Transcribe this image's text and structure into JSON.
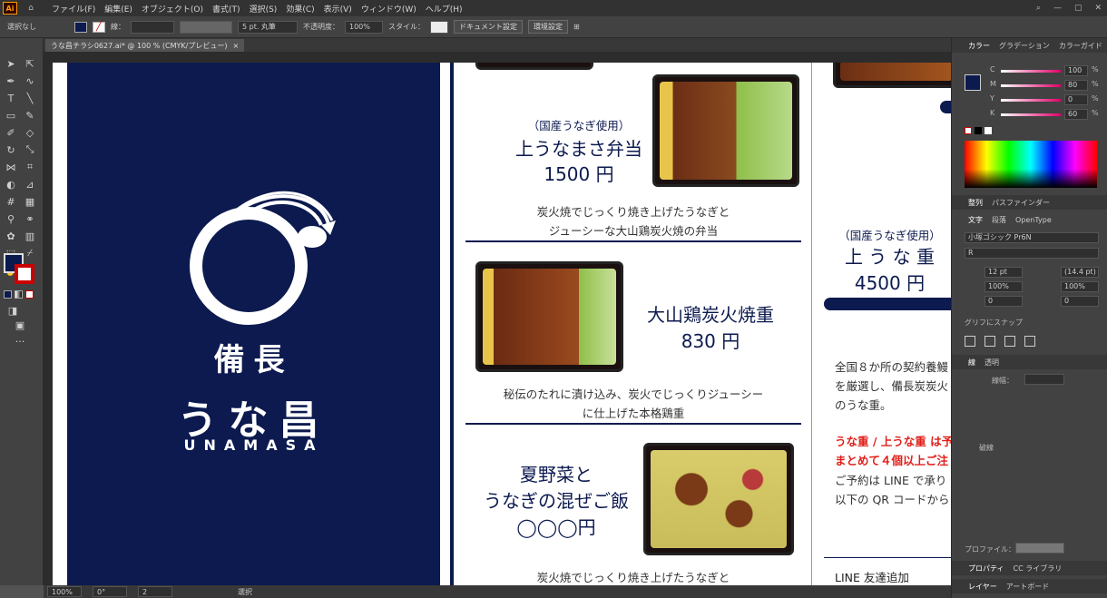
{
  "menu": {
    "app_badge": "Ai",
    "items": [
      "ファイル(F)",
      "編集(E)",
      "オブジェクト(O)",
      "書式(T)",
      "選択(S)",
      "効果(C)",
      "表示(V)",
      "ウィンドウ(W)",
      "ヘルプ(H)"
    ]
  },
  "control": {
    "selection": "選択なし",
    "stroke_label": "線：",
    "brush": "5 pt. 丸筆",
    "opacity_label": "不透明度：",
    "opacity": "100%",
    "style_label": "スタイル：",
    "doc_setup": "ドキュメント設定",
    "prefs": "環境設定"
  },
  "doc_tab": {
    "title": "うな昌チラシ0627.ai* @ 100 % (CMYK/プレビュー)",
    "close": "×"
  },
  "canvas": {
    "brand": {
      "line1": "備長",
      "line2": "うな昌",
      "line3": "UNAMASA"
    },
    "item1": {
      "tag": "（国産うなぎ使用）",
      "name": "上うなまさ弁当",
      "price": "1500 円",
      "desc1": "炭火焼でじっくり焼き上げたうなぎと",
      "desc2": "ジューシーな大山鶏炭火焼の弁当"
    },
    "item2": {
      "name": "大山鶏炭火焼重",
      "price": "830 円",
      "desc1": "秘伝のたれに漬け込み、炭火でじっくりジューシー",
      "desc2": "に仕上げた本格鶏重"
    },
    "item3": {
      "name1": "夏野菜と",
      "name2": "うなぎの混ぜご飯",
      "price": "◯◯◯円",
      "desc1": "炭火焼でじっくり焼き上げたうなぎと"
    },
    "item4": {
      "tag": "（国産うなぎ使用）",
      "name": "上 う な 重",
      "price": "4500 円"
    },
    "side": {
      "p1": "全国８か所の契約養鰻",
      "p2": "を厳選し、備長炭炭火",
      "p3": "のうな重。",
      "r1": "うな重 / 上うな重 は予",
      "r2": "まとめて４個以上ご注",
      "p4": "ご予約は LINE で承り",
      "p5": "以下の QR コードから",
      "line": "LINE 友達追加"
    }
  },
  "panel": {
    "tabs1": [
      "カラー",
      "グラデーション",
      "カラーガイド"
    ],
    "cmyk": [
      {
        "k": "C",
        "v": "100",
        "pct": "%"
      },
      {
        "k": "M",
        "v": "80",
        "pct": "%"
      },
      {
        "k": "Y",
        "v": "0",
        "pct": "%"
      },
      {
        "k": "K",
        "v": "60",
        "pct": "%"
      }
    ],
    "tabs2": [
      "整列",
      "パスファインダー"
    ],
    "tabs3": [
      "文字",
      "段落",
      "OpenType"
    ],
    "font": "小塚ゴシック Pr6N",
    "weight": "R",
    "size": "12 pt",
    "leading": "(14.4 pt)",
    "scale1": "100%",
    "scale2": "100%",
    "kern": "0",
    "track": "0",
    "snap": "グリフにスナップ",
    "stroke_tabs": [
      "線",
      "透明"
    ],
    "weight_label": "線幅：",
    "dashed": "破線",
    "profile_label": "プロファイル：",
    "bottom_tabs": [
      "プロパティ",
      "CC ライブラリ"
    ],
    "bottom2": [
      "レイヤー",
      "アートボード"
    ]
  },
  "status": {
    "zoom": "100%",
    "angle": "0°",
    "page": "2",
    "mode": "選択"
  }
}
